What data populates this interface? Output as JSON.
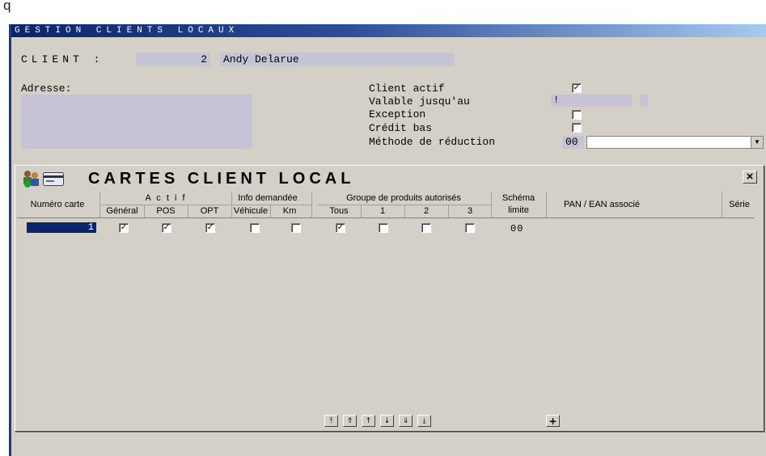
{
  "corner_char": "q",
  "window_title": "GESTION CLIENTS LOCAUX",
  "client": {
    "label": "CLIENT :",
    "number": "2",
    "name": "Andy Delarue"
  },
  "address_label": "Adresse:",
  "options": {
    "active_label": "Client actif",
    "active_checked": true,
    "valid_label": "Valable jusqu'au",
    "valid_value": "!",
    "exception_label": "Exception",
    "exception_checked": false,
    "credit_label": "Crédit bas",
    "credit_checked": false,
    "reduction_label": "Méthode de réduction",
    "reduction_code": "00",
    "reduction_value": ""
  },
  "panel": {
    "title": "CARTES CLIENT LOCAL",
    "close_label": "×",
    "headers": {
      "card_number": "Numéro carte",
      "actif": "A c t i f",
      "info": "Info demandée",
      "group": "Groupe de produits autorisés",
      "schema": "Schéma",
      "schema2": "limite",
      "pan": "PAN / EAN associé",
      "serie": "Série",
      "general": "Général",
      "pos": "POS",
      "opt": "OPT",
      "vehicule": "Véhicule",
      "km": "Km",
      "tous": "Tous",
      "g1": "1",
      "g2": "2",
      "g3": "3"
    },
    "rows": [
      {
        "card": "1",
        "general": true,
        "pos": true,
        "opt": true,
        "vehicule": false,
        "km": false,
        "tous": true,
        "g1": false,
        "g2": false,
        "g3": false,
        "schema": "00",
        "pan": "",
        "serie": ""
      }
    ],
    "nav_icons": [
      "first-icon",
      "page-up-icon",
      "up-icon",
      "down-icon",
      "page-down-icon",
      "last-icon"
    ],
    "add_label": "+"
  }
}
